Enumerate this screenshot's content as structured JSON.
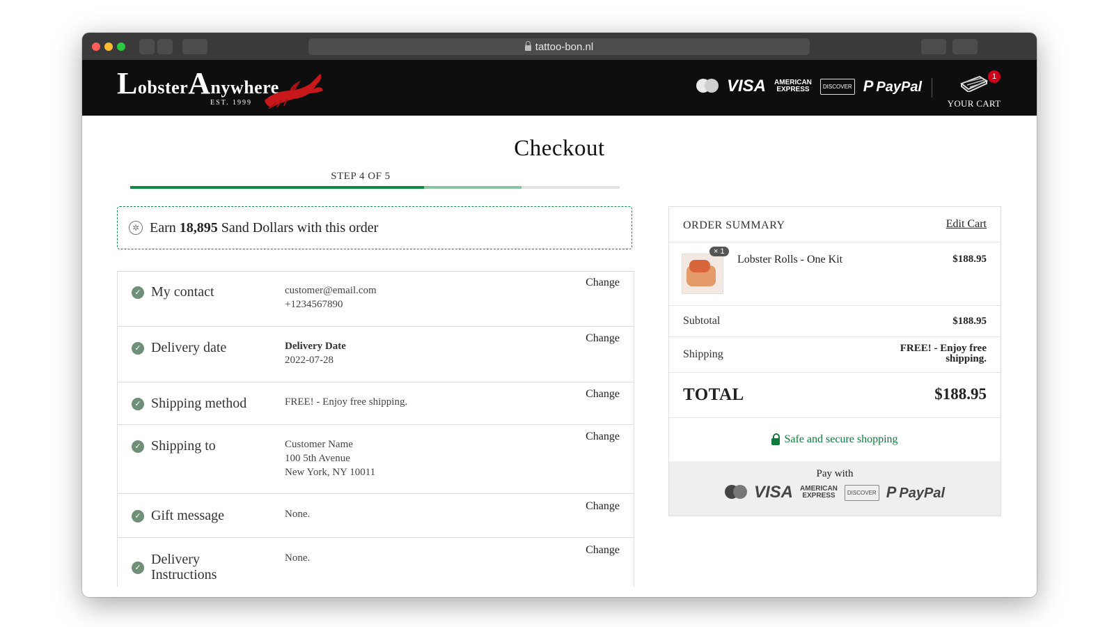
{
  "browser": {
    "url": "tattoo-bon.nl"
  },
  "header": {
    "logo_text": "obster",
    "logo_big_l": "L",
    "logo_big_a": "A",
    "logo_rest": "nywhere",
    "logo_est": "EST. 1999",
    "payment_marks": {
      "visa": "VISA",
      "amex_line1": "AMERICAN",
      "amex_line2": "EXPRESS",
      "discover": "DISCOVER",
      "paypal": "PayPal"
    },
    "cart_label": "YOUR CART",
    "cart_count": "1"
  },
  "page": {
    "title": "Checkout",
    "step_label": "STEP 4 OF 5",
    "progress": {
      "completed_fraction": 0.6,
      "in_progress_fraction": 0.8
    }
  },
  "rewards": {
    "prefix": "Earn",
    "amount": "18,895",
    "suffix": "Sand Dollars with this order"
  },
  "steps": {
    "change_label": "Change",
    "contact": {
      "name": "My contact",
      "email": "customer@email.com",
      "phone": "+1234567890"
    },
    "delivery_date": {
      "name": "Delivery date",
      "label": "Delivery Date",
      "value": "2022-07-28"
    },
    "shipping_method": {
      "name": "Shipping method",
      "value": "FREE! - Enjoy free shipping."
    },
    "shipping_to": {
      "name": "Shipping to",
      "line1": "Customer Name",
      "line2": "100 5th Avenue",
      "line3": "New York, NY 10011"
    },
    "gift_message": {
      "name": "Gift message",
      "value": "None."
    },
    "delivery_instructions": {
      "name_line1": "Delivery",
      "name_line2": "Instructions",
      "value": "None."
    }
  },
  "summary": {
    "title": "ORDER SUMMARY",
    "edit_cart": "Edit Cart",
    "item": {
      "qty": "× 1",
      "name": "Lobster Rolls - One Kit",
      "price": "$188.95"
    },
    "subtotal_label": "Subtotal",
    "subtotal_value": "$188.95",
    "shipping_label": "Shipping",
    "shipping_value_line1": "FREE! - Enjoy free",
    "shipping_value_line2": "shipping.",
    "total_label": "TOTAL",
    "total_value": "$188.95",
    "secure_text": "Safe and secure shopping",
    "pay_with": "Pay with"
  },
  "colors": {
    "accent_green": "#0e8a43",
    "header_bg": "#0e0e0e",
    "cart_badge": "#d0021b"
  }
}
